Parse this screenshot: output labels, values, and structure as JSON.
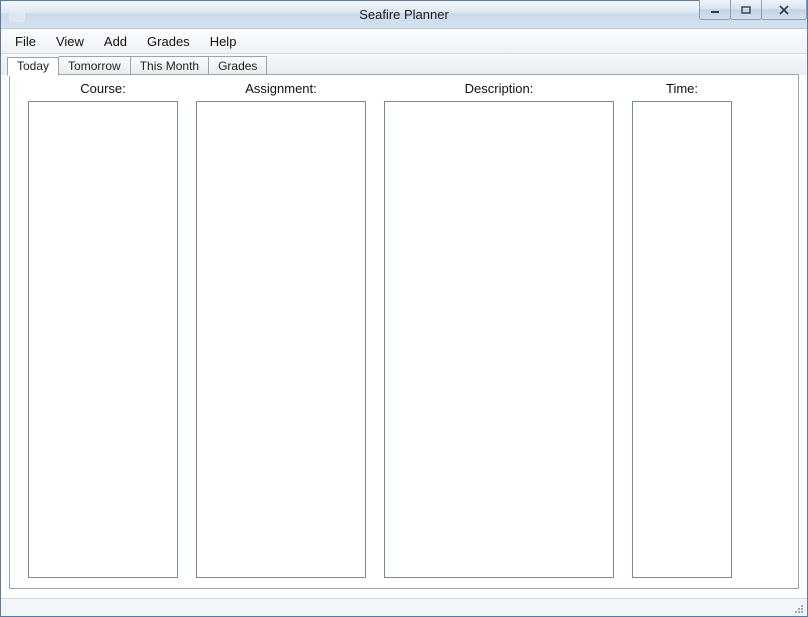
{
  "window": {
    "title": "Seafire Planner"
  },
  "menu": {
    "items": [
      "File",
      "View",
      "Add",
      "Grades",
      "Help"
    ]
  },
  "tabs": {
    "items": [
      "Today",
      "Tomorrow",
      "This Month",
      "Grades"
    ],
    "active_index": 0
  },
  "columns": {
    "course_label": "Course:",
    "assignment_label": "Assignment:",
    "description_label": "Description:",
    "time_label": "Time:",
    "course_items": [],
    "assignment_items": [],
    "description_items": [],
    "time_items": []
  }
}
